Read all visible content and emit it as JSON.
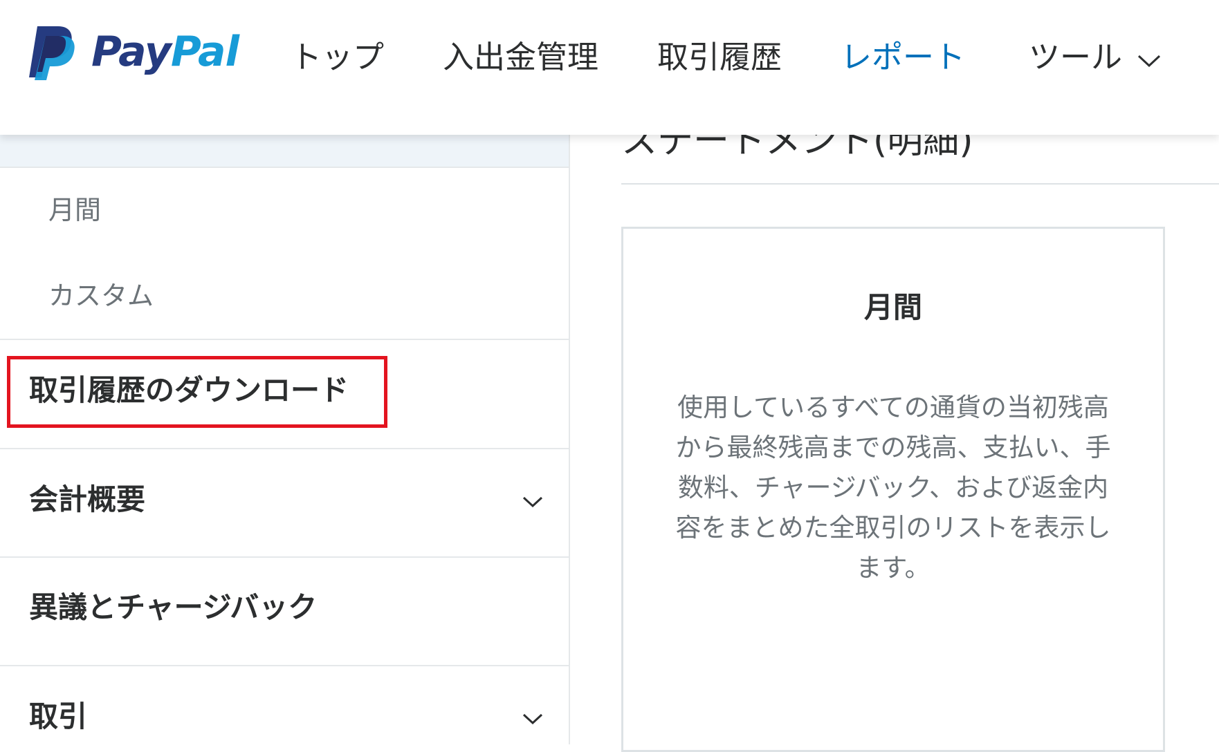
{
  "brand": {
    "name_pay": "Pay",
    "name_pal": "Pal",
    "colors": {
      "dark_blue": "#253b80",
      "light_blue": "#179bd7"
    }
  },
  "nav": {
    "items": [
      {
        "label": "トップ"
      },
      {
        "label": "入出金管理"
      },
      {
        "label": "取引履歴"
      },
      {
        "label": "レポート",
        "active": true
      },
      {
        "label": "ツール"
      }
    ],
    "active_color": "#0070ba"
  },
  "sidebar": {
    "sub_items": [
      "月間",
      "カスタム"
    ],
    "sections": [
      {
        "label": "取引履歴のダウンロード",
        "highlighted": true
      },
      {
        "label": "会計概要",
        "expandable": true
      },
      {
        "label": "異議とチャージバック"
      },
      {
        "label": "取引",
        "expandable": true
      }
    ],
    "highlight_color": "#e3141f"
  },
  "main": {
    "title": "ステートメント(明細)",
    "card": {
      "title": "月間",
      "description": "使用しているすべての通貨の当初残高から最終残高までの残高、支払い、手数料、チャージバック、および返金内容をまとめた全取引のリストを表示します。"
    }
  }
}
